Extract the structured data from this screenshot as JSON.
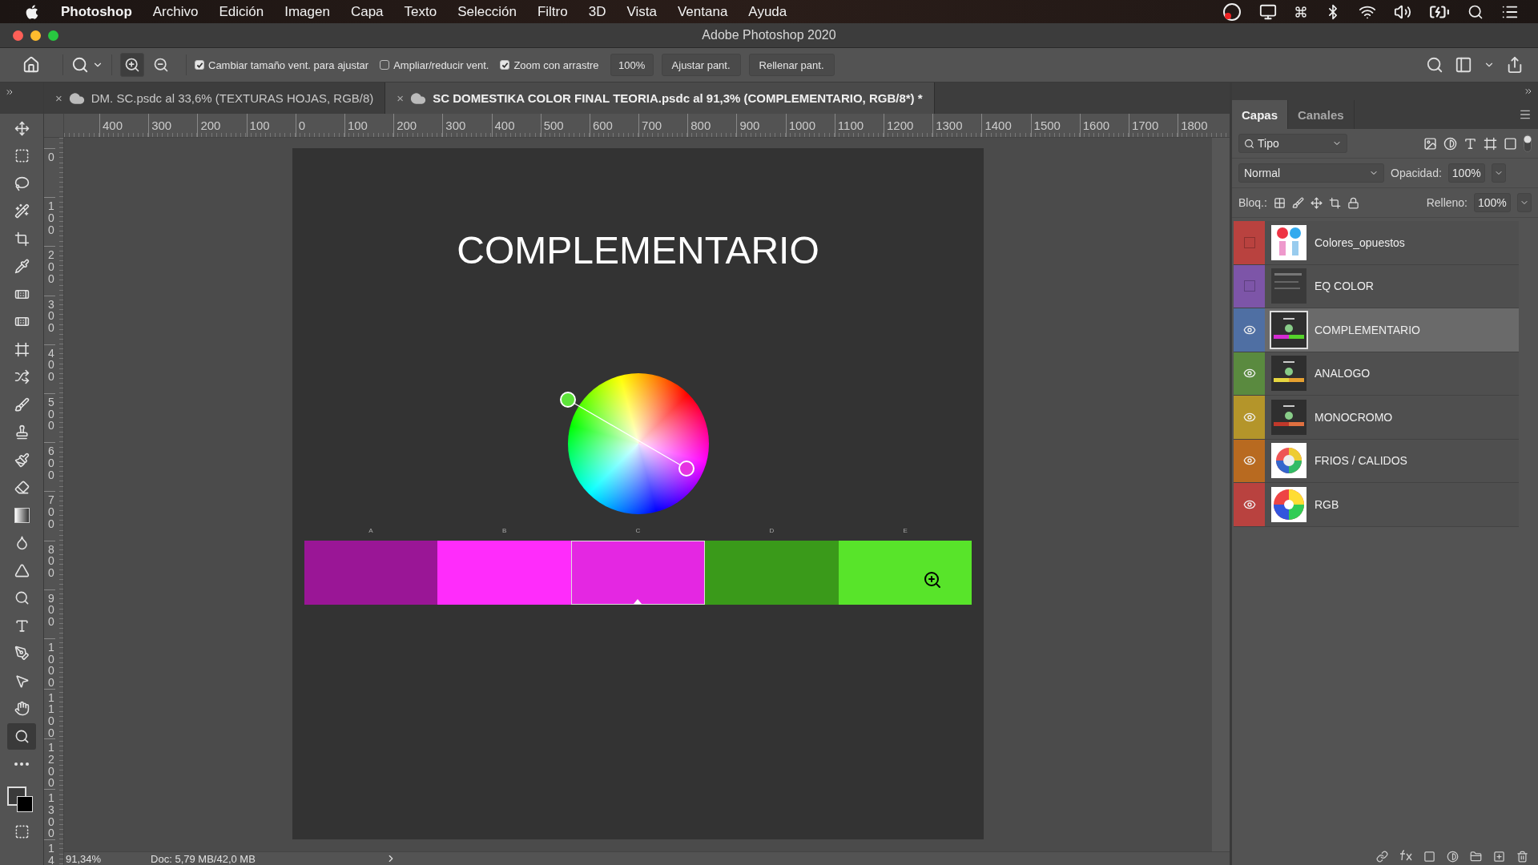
{
  "menu_bar": {
    "app": "Photoshop",
    "items": [
      "Archivo",
      "Edición",
      "Imagen",
      "Capa",
      "Texto",
      "Selección",
      "Filtro",
      "3D",
      "Vista",
      "Ventana",
      "Ayuda"
    ]
  },
  "window": {
    "title": "Adobe Photoshop 2020"
  },
  "options_bar": {
    "zoom_modes": [
      {
        "kind": "in",
        "selected": true
      },
      {
        "kind": "out",
        "selected": false
      }
    ],
    "checkboxes": [
      {
        "label": "Cambiar tamaño vent. para ajustar",
        "checked": true
      },
      {
        "label": "Ampliar/reducir vent.",
        "checked": false
      },
      {
        "label": "Zoom con arrastre",
        "checked": true
      }
    ],
    "zoom_value": "100%",
    "buttons": [
      "Ajustar pant.",
      "Rellenar pant."
    ]
  },
  "document_tabs": [
    {
      "title": "DM. SC.psdc al 33,6% (TEXTURAS HOJAS, RGB/8)",
      "close": "×",
      "selected": false
    },
    {
      "title": "SC DOMESTIKA COLOR FINAL TEORIA.psdc al 91,3% (COMPLEMENTARIO, RGB/8*) *",
      "close": "×",
      "selected": true
    }
  ],
  "tools": [
    {
      "kind": "move",
      "selected": false
    },
    {
      "kind": "marquee",
      "selected": false
    },
    {
      "kind": "lasso",
      "selected": false
    },
    {
      "kind": "quick-select",
      "selected": false
    },
    {
      "kind": "crop",
      "selected": false
    },
    {
      "kind": "eyedropper",
      "selected": false
    },
    {
      "kind": "healing",
      "selected": false
    },
    {
      "kind": "patch",
      "selected": false
    },
    {
      "kind": "frame",
      "selected": false
    },
    {
      "kind": "content-move",
      "selected": false
    },
    {
      "kind": "brush",
      "selected": false
    },
    {
      "kind": "stamp",
      "selected": false
    },
    {
      "kind": "history-brush",
      "selected": false
    },
    {
      "kind": "eraser",
      "selected": false
    },
    {
      "kind": "gradient",
      "selected": false
    },
    {
      "kind": "smudge",
      "selected": false
    },
    {
      "kind": "sharpen",
      "selected": false
    },
    {
      "kind": "dodge",
      "selected": false
    },
    {
      "kind": "type",
      "selected": false
    },
    {
      "kind": "pen",
      "selected": false
    },
    {
      "kind": "path-select",
      "selected": false
    },
    {
      "kind": "hand",
      "selected": false
    },
    {
      "kind": "zoom",
      "selected": true
    },
    {
      "kind": "more",
      "selected": false
    }
  ],
  "rulers": {
    "horizontal": [
      "400",
      "300",
      "200",
      "100",
      "0",
      "100",
      "200",
      "300",
      "400",
      "500",
      "600",
      "700",
      "800",
      "900",
      "1000",
      "1100",
      "1200",
      "1300",
      "1400",
      "1500",
      "1600",
      "1700",
      "1800"
    ],
    "vertical": [
      "0",
      "100",
      "200",
      "300",
      "400",
      "500",
      "600",
      "700",
      "800",
      "900",
      "1000",
      "1100",
      "1200",
      "1300",
      "14"
    ]
  },
  "document": {
    "title": "COMPLEMENTARIO",
    "swatches": [
      {
        "label": "A",
        "color": "#9a1696",
        "selected": false
      },
      {
        "label": "B",
        "color": "#ff2cfb",
        "selected": false
      },
      {
        "label": "C",
        "color": "#e427e2",
        "selected": true
      },
      {
        "label": "D",
        "color": "#3a9a1a",
        "selected": false
      },
      {
        "label": "E",
        "color": "#58e42a",
        "selected": false
      }
    ]
  },
  "status_bar": {
    "zoom": "91,34%",
    "doc": "Doc: 5,79 MB/42,0 MB"
  },
  "layers_panel": {
    "tabs": [
      {
        "label": "Capas",
        "selected": true
      },
      {
        "label": "Canales",
        "selected": false
      }
    ],
    "filter": "Tipo",
    "blend_mode": "Normal",
    "opacity_label": "Opacidad:",
    "opacity": "100%",
    "lock_label": "Bloq.:",
    "fill_label": "Relleno:",
    "fill": "100%",
    "layers": [
      {
        "name": "Colores_opuestos",
        "color": "#b9423f",
        "visible": false,
        "selected": false,
        "kind": "light-sheet"
      },
      {
        "name": "EQ COLOR",
        "color": "#7d55a8",
        "visible": false,
        "selected": false,
        "kind": "dark-screen"
      },
      {
        "name": "COMPLEMENTARIO",
        "color": "#4f6fa3",
        "visible": true,
        "selected": true,
        "kind": "slide-complementary"
      },
      {
        "name": "ANALOGO",
        "color": "#5a8a3f",
        "visible": true,
        "selected": false,
        "kind": "slide-analogous"
      },
      {
        "name": "MONOCROMO",
        "color": "#b4952a",
        "visible": true,
        "selected": false,
        "kind": "slide-mono"
      },
      {
        "name": "FRIOS / CALIDOS",
        "color": "#b86a20",
        "visible": true,
        "selected": false,
        "kind": "wheel-ring"
      },
      {
        "name": "RGB",
        "color": "#b9423f",
        "visible": true,
        "selected": false,
        "kind": "wheel-blur"
      }
    ]
  }
}
